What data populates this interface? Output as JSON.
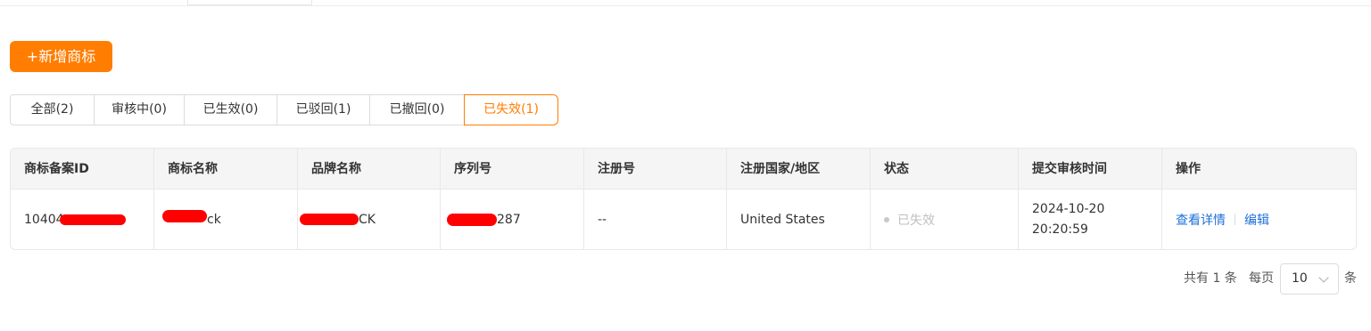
{
  "toolbar": {
    "add_label": "+新增商标"
  },
  "tabs": [
    {
      "label": "全部(2)"
    },
    {
      "label": "审核中(0)"
    },
    {
      "label": "已生效(0)"
    },
    {
      "label": "已驳回(1)"
    },
    {
      "label": "已撤回(0)"
    },
    {
      "label": "已失效(1)",
      "active": true
    }
  ],
  "table": {
    "headers": [
      "商标备案ID",
      "商标名称",
      "品牌名称",
      "序列号",
      "注册号",
      "注册国家/地区",
      "状态",
      "提交审核时间",
      "操作"
    ],
    "rows": [
      {
        "id_visible": "10404",
        "trademark_visible": "ck",
        "brand_visible": "CK",
        "serial_visible": "287",
        "reg_no": "--",
        "country": "United States",
        "status": "已失效",
        "submit_date": "2024-10-20",
        "submit_time": "20:20:59",
        "actions": {
          "view": "查看详情",
          "edit": "编辑"
        }
      }
    ]
  },
  "pagination": {
    "total_text": "共有 1 条",
    "per_page_label": "每页",
    "per_page_value": "10",
    "unit": "条"
  },
  "colors": {
    "accent": "#ff7d00",
    "link": "#1e6fd9",
    "redaction": "#ff0000"
  }
}
